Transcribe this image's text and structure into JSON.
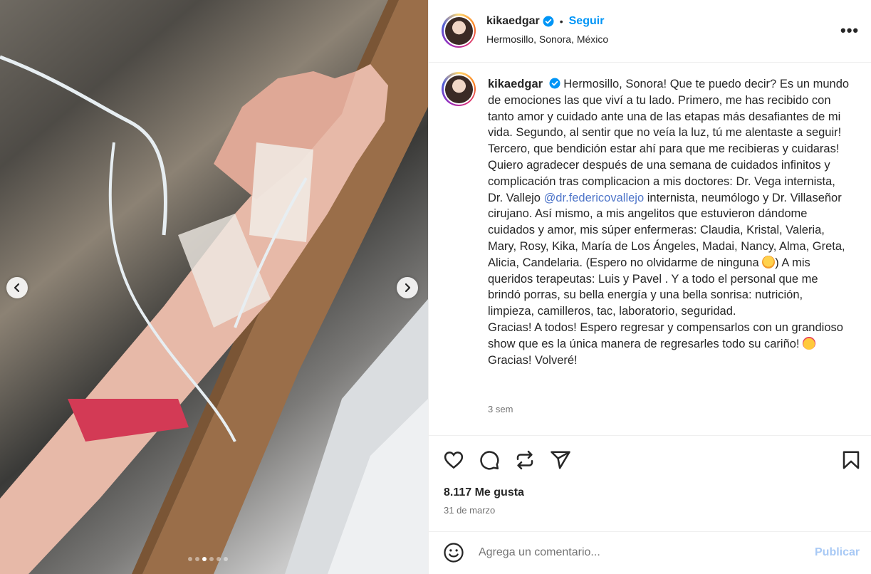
{
  "post": {
    "username": "kikaedgar",
    "follow_label": "Seguir",
    "separator": "•",
    "location": "Hermosillo, Sonora, México",
    "more_label": "•••"
  },
  "caption": {
    "username": "kikaedgar",
    "text_part1": "Hermosillo, Sonora! Que te puedo decir? Es un mundo de emociones las que viví a tu lado. Primero, me has recibido con tanto amor y cuidado ante una de las etapas más desafiantes de mi vida. Segundo, al sentir que no veía la luz, tú me alentaste a seguir! Tercero, que bendición estar ahí para que me recibieras y cuidaras!\nQuiero agradecer después de una semana de cuidados infinitos y complicación tras complicacion a mis doctores: Dr. Vega internista, Dr. Vallejo ",
    "mention": "@dr.federicovallejo",
    "text_part2": " internista, neumólogo y Dr. Villaseñor cirujano. Así mismo, a mis angelitos que estuvieron dándome cuidados y amor, mis súper enfermeras: Claudia, Kristal, Valeria, Mary, Rosy, Kika, María de Los Ángeles, Madai, Nancy, Alma, Greta, Alicia, Candelaria. (Espero no olvidarme de ninguna ",
    "text_part3": ") A mis queridos terapeutas: Luis y Pavel . Y a todo el personal que me brindó porras, su bella energía y una bella sonrisa: nutrición, limpieza, camilleros, tac, laboratorio, seguridad.\nGracias! A todos! Espero regresar y compensarlos con un grandioso show que es la única manera de regresarles todo su cariño! ",
    "text_part4": " Gracias! Volveré!",
    "time_ago": "3 sem"
  },
  "engagement": {
    "likes": "8.117 Me gusta",
    "date": "31 de marzo"
  },
  "comment": {
    "placeholder": "Agrega un comentario...",
    "publish_label": "Publicar"
  },
  "carousel": {
    "total_slides": 6,
    "active_slide": 3
  },
  "icons": {
    "verified": "verified-badge-icon",
    "like": "heart-icon",
    "comment": "comment-icon",
    "repost": "repost-icon",
    "share": "send-icon",
    "save": "bookmark-icon",
    "emoji": "smiley-icon",
    "prev": "chevron-left-icon",
    "next": "chevron-right-icon"
  },
  "colors": {
    "accent": "#0095f6",
    "mention": "#4e75c9",
    "publish_disabled": "#a8c9f5",
    "muted": "#737373"
  }
}
